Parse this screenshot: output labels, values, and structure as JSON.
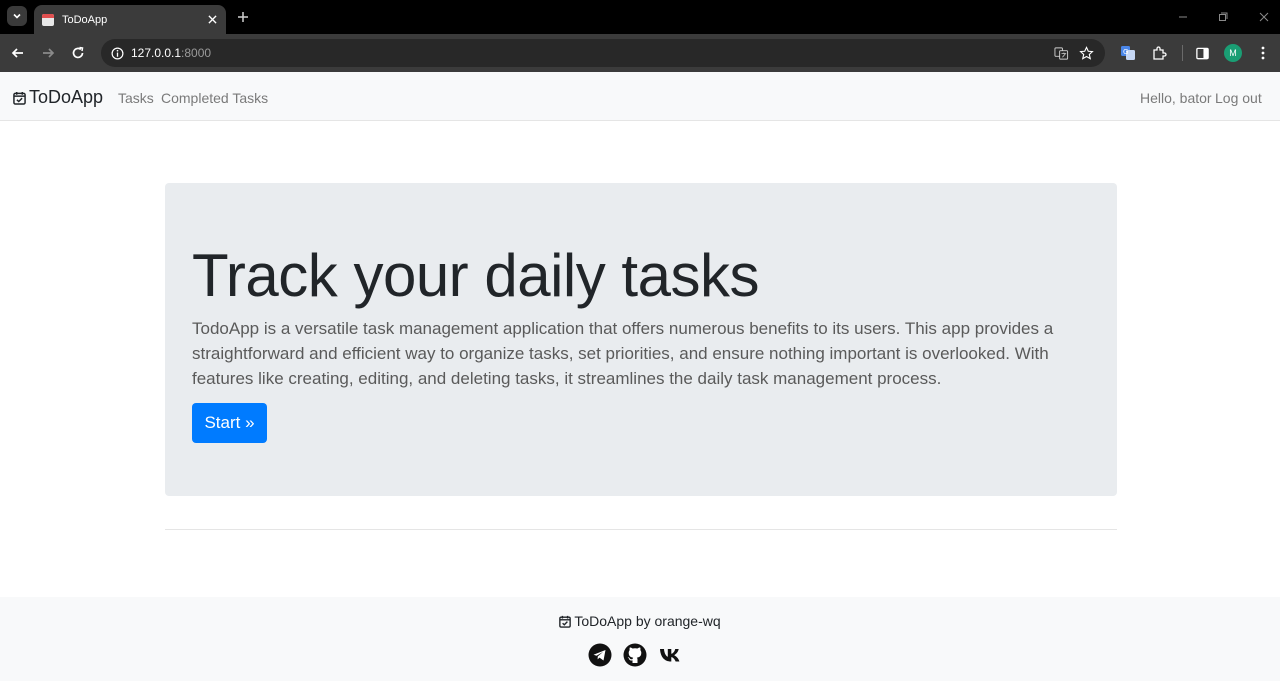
{
  "browser": {
    "tab_title": "ToDoApp",
    "url_host": "127.0.0.1",
    "url_port": ":8000",
    "profile_initial": "M"
  },
  "navbar": {
    "brand": "ToDoApp",
    "links": [
      "Tasks",
      "Completed Tasks"
    ],
    "greeting": "Hello, bator",
    "logout": "Log out"
  },
  "hero": {
    "title": "Track your daily tasks",
    "description": "TodoApp is a versatile task management application that offers numerous benefits to its users. This app provides a straightforward and efficient way to organize tasks, set priorities, and ensure nothing important is overlooked. With features like creating, editing, and deleting tasks, it streamlines the daily task management process.",
    "button": "Start »"
  },
  "footer": {
    "credit": "ToDoApp by orange-wq",
    "social_icons": [
      "telegram-icon",
      "github-icon",
      "vk-icon"
    ]
  },
  "colors": {
    "primary": "#007bff",
    "jumbotron_bg": "#e9ecef",
    "navbar_bg": "#f8f9fa"
  }
}
